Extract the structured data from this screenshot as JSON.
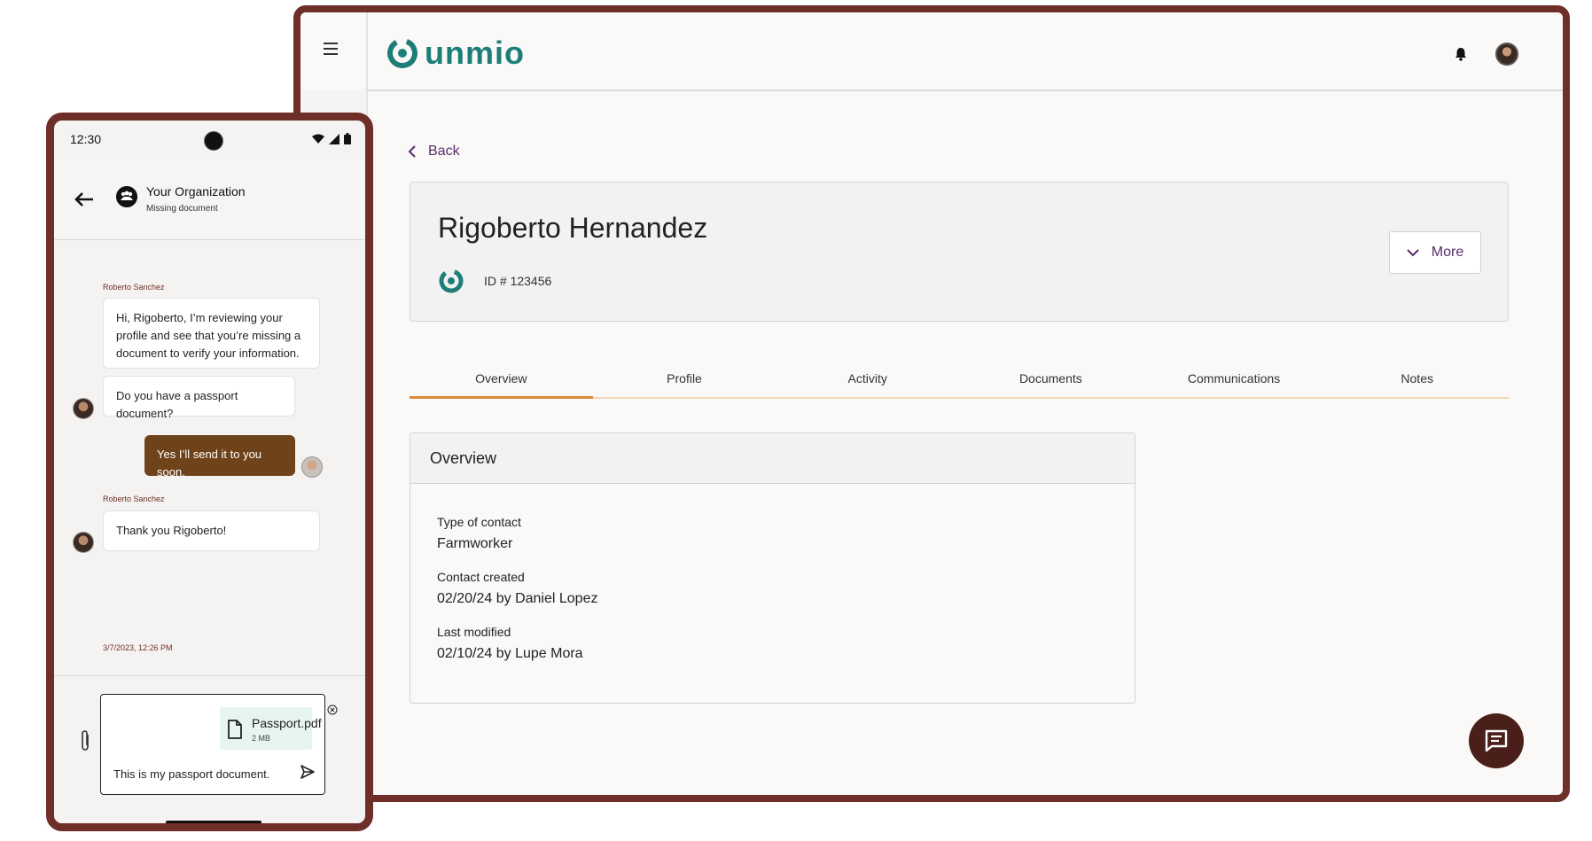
{
  "desktop": {
    "brand": "unmio",
    "back_label": "Back",
    "contact": {
      "name": "Rigoberto Hernandez",
      "id_label": "ID # 123456"
    },
    "more_label": "More",
    "tabs": [
      {
        "label": "Overview",
        "active": true
      },
      {
        "label": "Profile"
      },
      {
        "label": "Activity"
      },
      {
        "label": "Documents"
      },
      {
        "label": "Communications"
      },
      {
        "label": "Notes"
      }
    ],
    "overview": {
      "title": "Overview",
      "fields": [
        {
          "label": "Type of contact",
          "value": "Farmworker"
        },
        {
          "label": "Contact created",
          "value": "02/20/24 by Daniel Lopez"
        },
        {
          "label": "Last modified",
          "value": "02/10/24 by Lupe Mora"
        }
      ]
    },
    "colors": {
      "frame": "#6e2f28",
      "brand_teal": "#1d7e78",
      "link_purple": "#5b2a6e",
      "tab_active": "#e08a3a",
      "fab": "#4a1f1a"
    }
  },
  "phone": {
    "time": "12:30",
    "org_name": "Your Organization",
    "org_subtitle": "Missing document",
    "messages": [
      {
        "sender": "Roberto Sanchez",
        "text": "Hi, Rigoberto, I’m reviewing your profile and see that you’re missing a document to verify your information."
      },
      {
        "text": "Do you have a passport document?"
      },
      {
        "text": "Yes I’ll send it to you soon.",
        "outgoing": true
      },
      {
        "sender": "Roberto Sanchez",
        "text": "Thank you Rigoberto!"
      }
    ],
    "timestamp": "3/7/2023, 12:26 PM",
    "attachment": {
      "name": "Passport.pdf",
      "size": "2 MB"
    },
    "composer_text": "This is my passport document.",
    "colors": {
      "outgoing_bubble": "#6f4319",
      "attachment_bg": "#e6f5f2"
    }
  }
}
